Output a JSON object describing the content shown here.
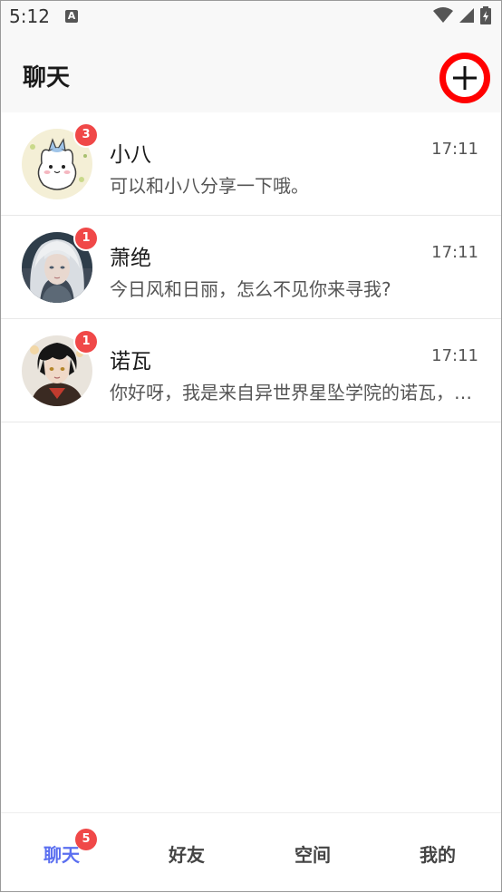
{
  "status_bar": {
    "time": "5:12",
    "notification_icon": "A"
  },
  "header": {
    "title": "聊天",
    "add_icon": "plus-icon"
  },
  "chats": [
    {
      "name": "小八",
      "time": "17:11",
      "preview": "可以和小八分享一下哦。",
      "unread": "3",
      "avatar": "cartoon-cat-avatar"
    },
    {
      "name": "萧绝",
      "time": "17:11",
      "preview": "今日风和日丽，怎么不见你来寻我?",
      "unread": "1",
      "avatar": "white-hair-man-avatar"
    },
    {
      "name": "诺瓦",
      "time": "17:11",
      "preview": "你好呀，我是来自异世界星坠学院的诺瓦，很高兴认识你",
      "unread": "1",
      "avatar": "black-hair-boy-avatar"
    }
  ],
  "bottom_nav": {
    "tabs": [
      {
        "label": "聊天",
        "active": true,
        "badge": "5"
      },
      {
        "label": "好友",
        "active": false
      },
      {
        "label": "空间",
        "active": false
      },
      {
        "label": "我的",
        "active": false
      }
    ]
  },
  "colors": {
    "accent": "#5b6ff0",
    "badge": "#f04848",
    "highlight_ring": "#ff0000"
  }
}
